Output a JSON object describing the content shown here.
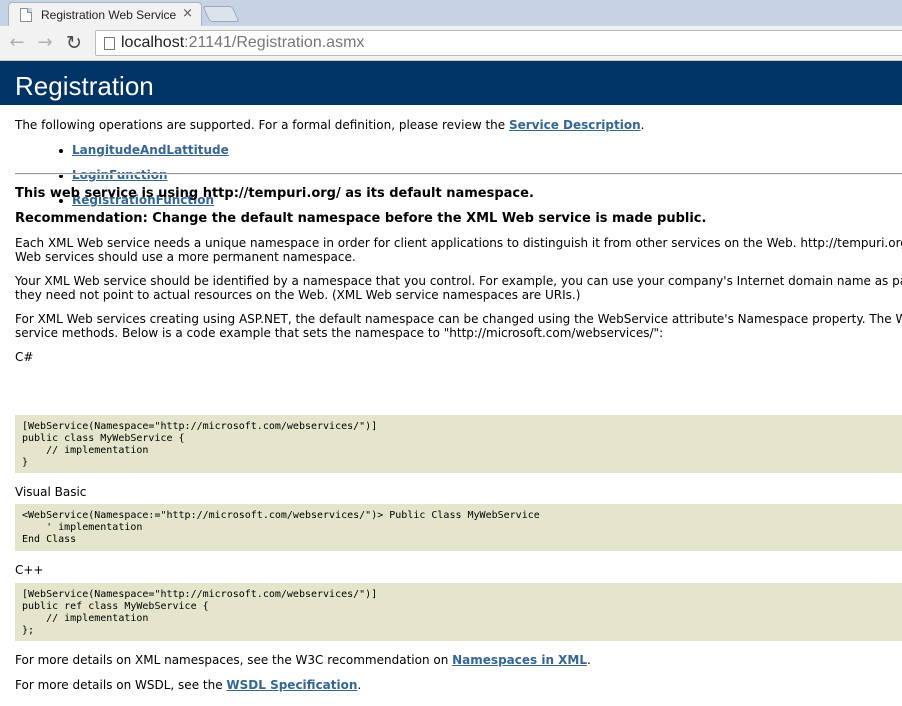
{
  "browser": {
    "tab_title": "Registration Web Service",
    "tab_close": "×",
    "back_icon": "←",
    "forward_icon": "→",
    "reload_icon": "↻",
    "url_host": "localhost",
    "url_path": ":21141/Registration.asmx"
  },
  "page": {
    "title": "Registration",
    "intro_text": "The following operations are supported. For a formal definition, please review the ",
    "service_description_link": "Service Description",
    "intro_end": ".",
    "operations": [
      "LangitudeAndLattitude",
      "LoginFunction",
      "RegistrationFunction"
    ],
    "namespace_notice": "This web service is using http://tempuri.org/ as its default namespace.",
    "recommendation": "Recommendation: Change the default namespace before the XML Web service is made public.",
    "para1_line1": "Each XML Web service needs a unique namespace in order for client applications to distinguish it from other services on the Web. http://tempuri.org/ is ava",
    "para1_line2": "Web services should use a more permanent namespace.",
    "para2_line1": "Your XML Web service should be identified by a namespace that you control. For example, you can use your company's Internet domain name as part of th",
    "para2_line2": "they need not point to actual resources on the Web. (XML Web service namespaces are URIs.)",
    "para3_line1": "For XML Web services creating using ASP.NET, the default namespace can be changed using the WebService attribute's Namespace property. The WebServ",
    "para3_line2": "service methods. Below is a code example that sets the namespace to \"http://microsoft.com/webservices/\":",
    "csharp_label": "C#",
    "csharp_code": "[WebService(Namespace=\"http://microsoft.com/webservices/\")]\npublic class MyWebService {\n    // implementation\n}",
    "vb_label": "Visual Basic",
    "vb_code": "<WebService(Namespace:=\"http://microsoft.com/webservices/\")> Public Class MyWebService\n    ' implementation\nEnd Class",
    "cpp_label": "C++",
    "cpp_code": "[WebService(Namespace=\"http://microsoft.com/webservices/\")]\npublic ref class MyWebService {\n    // implementation\n};",
    "xml_ns_text": "For more details on XML namespaces, see the W3C recommendation on ",
    "xml_ns_link": "Namespaces in XML",
    "xml_ns_end": ".",
    "wsdl_text": "For more details on WSDL, see the ",
    "wsdl_link": "WSDL Specification",
    "wsdl_end": "."
  },
  "colors": {
    "header_bg": "#003366",
    "link": "#336699",
    "code_bg": "#e5e5cc"
  }
}
